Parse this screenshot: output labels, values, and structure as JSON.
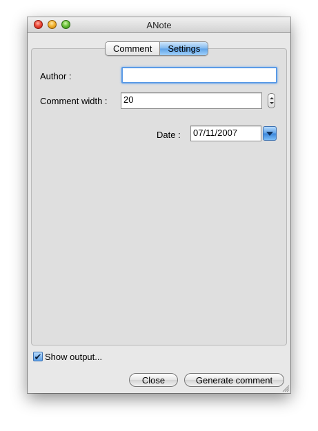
{
  "window": {
    "title": "ANote"
  },
  "tabs": [
    {
      "label": "Comment",
      "active": false
    },
    {
      "label": "Settings",
      "active": true
    }
  ],
  "settings": {
    "author_label": "Author :",
    "author_value": "",
    "width_label": "Comment width :",
    "width_value": "20",
    "date_label": "Date :",
    "date_value": "07/11/2007"
  },
  "footer": {
    "show_output_label": "Show output...",
    "show_output_checked": true,
    "close_label": "Close",
    "generate_label": "Generate comment"
  },
  "icons": {
    "checkmark": "✔"
  },
  "colors": {
    "accent": "#5fa2e7",
    "close_red": "#ee4b3a",
    "minimize_yellow": "#f4b430",
    "zoom_green": "#6cc23b"
  }
}
